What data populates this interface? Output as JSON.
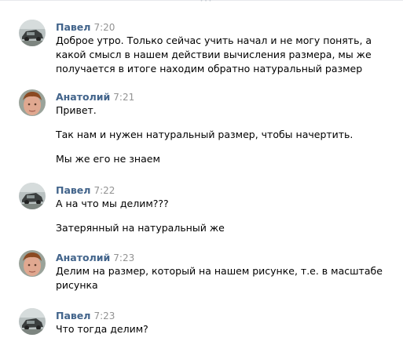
{
  "colors": {
    "author": "#42648b",
    "time": "#939393",
    "text": "#000000"
  },
  "messages": [
    {
      "author": "Павел",
      "time": "7:20",
      "avatar": "car-avatar",
      "lines": [
        "Доброе утро. Только сейчас учить начал и не могу понять, а какой смысл в нашем действии вычисления размера, мы же получается в итоге находим обратно натуральный размер"
      ]
    },
    {
      "author": "Анатолий",
      "time": "7:21",
      "avatar": "face-avatar",
      "lines": [
        "Привет.",
        "Так нам и нужен натуральный размер, чтобы начертить.",
        "Мы же его не знаем"
      ]
    },
    {
      "author": "Павел",
      "time": "7:22",
      "avatar": "car-avatar",
      "lines": [
        "А на что мы делим???",
        "Затерянный на натуральный же"
      ]
    },
    {
      "author": "Анатолий",
      "time": "7:23",
      "avatar": "face-avatar",
      "lines": [
        "Делим на размер, который на нашем рисунке, т.е. в масштабе рисунка"
      ]
    },
    {
      "author": "Павел",
      "time": "7:23",
      "avatar": "car-avatar",
      "lines": [
        "Что тогда делим?"
      ]
    }
  ]
}
